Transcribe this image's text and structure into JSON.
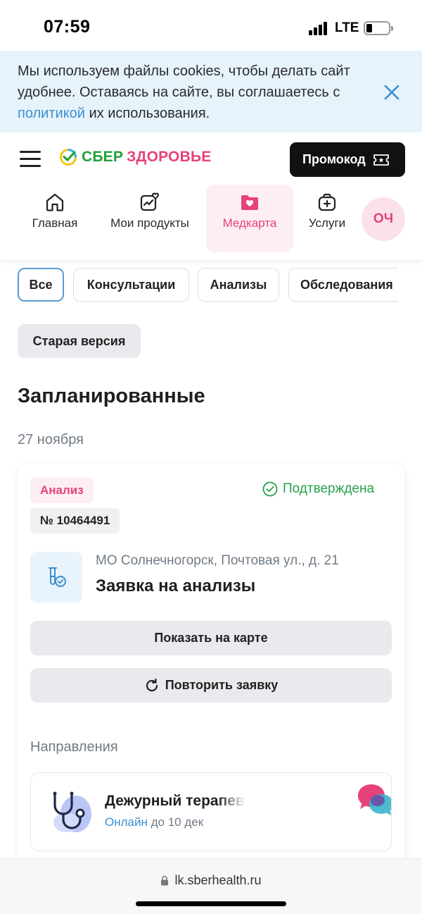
{
  "status_bar": {
    "time": "07:59",
    "network": "LTE"
  },
  "cookie_banner": {
    "text_before": "Мы используем файлы cookies, чтобы делать сайт удобнее. Оставаясь на сайте, вы соглашаетесь с ",
    "link_text": "политикой",
    "text_after": " их использования."
  },
  "header": {
    "logo_sber": "СБЕР",
    "logo_health": "ЗДОРОВЬЕ",
    "promo_label": "Промокод"
  },
  "nav": {
    "items": [
      {
        "label": "Главная",
        "icon": "home-icon"
      },
      {
        "label": "Мои продукты",
        "icon": "heart-chart-icon"
      },
      {
        "label": "Медкарта",
        "icon": "medical-folder-icon",
        "active": true
      },
      {
        "label": "Услуги",
        "icon": "medical-bag-icon"
      }
    ],
    "avatar_initials": "ОЧ"
  },
  "filters": {
    "chips": [
      "Все",
      "Консультации",
      "Анализы",
      "Обследования"
    ],
    "active": "Все"
  },
  "old_version_label": "Старая версия",
  "section_title": "Запланированные",
  "date_label": "27 ноября",
  "appointment": {
    "tag": "Анализ",
    "status": "Подтверждена",
    "order_number": "№ 10464491",
    "address": "МО Солнечногорск, Почтовая ул., д. 21",
    "title": "Заявка на анализы",
    "show_map_label": "Показать на карте",
    "repeat_label": "Повторить заявку",
    "directions_label": "Направления",
    "direction": {
      "name": "Дежурный терапевт",
      "online_label": "Онлайн",
      "until_label": "до 10 дек"
    }
  },
  "url_bar": {
    "url": "lk.sberhealth.ru"
  },
  "colors": {
    "brand_green": "#21a038",
    "brand_pink": "#e6427a",
    "link_blue": "#3a8fd0",
    "status_green": "#27a04a",
    "banner_bg": "#e6f3fb"
  }
}
